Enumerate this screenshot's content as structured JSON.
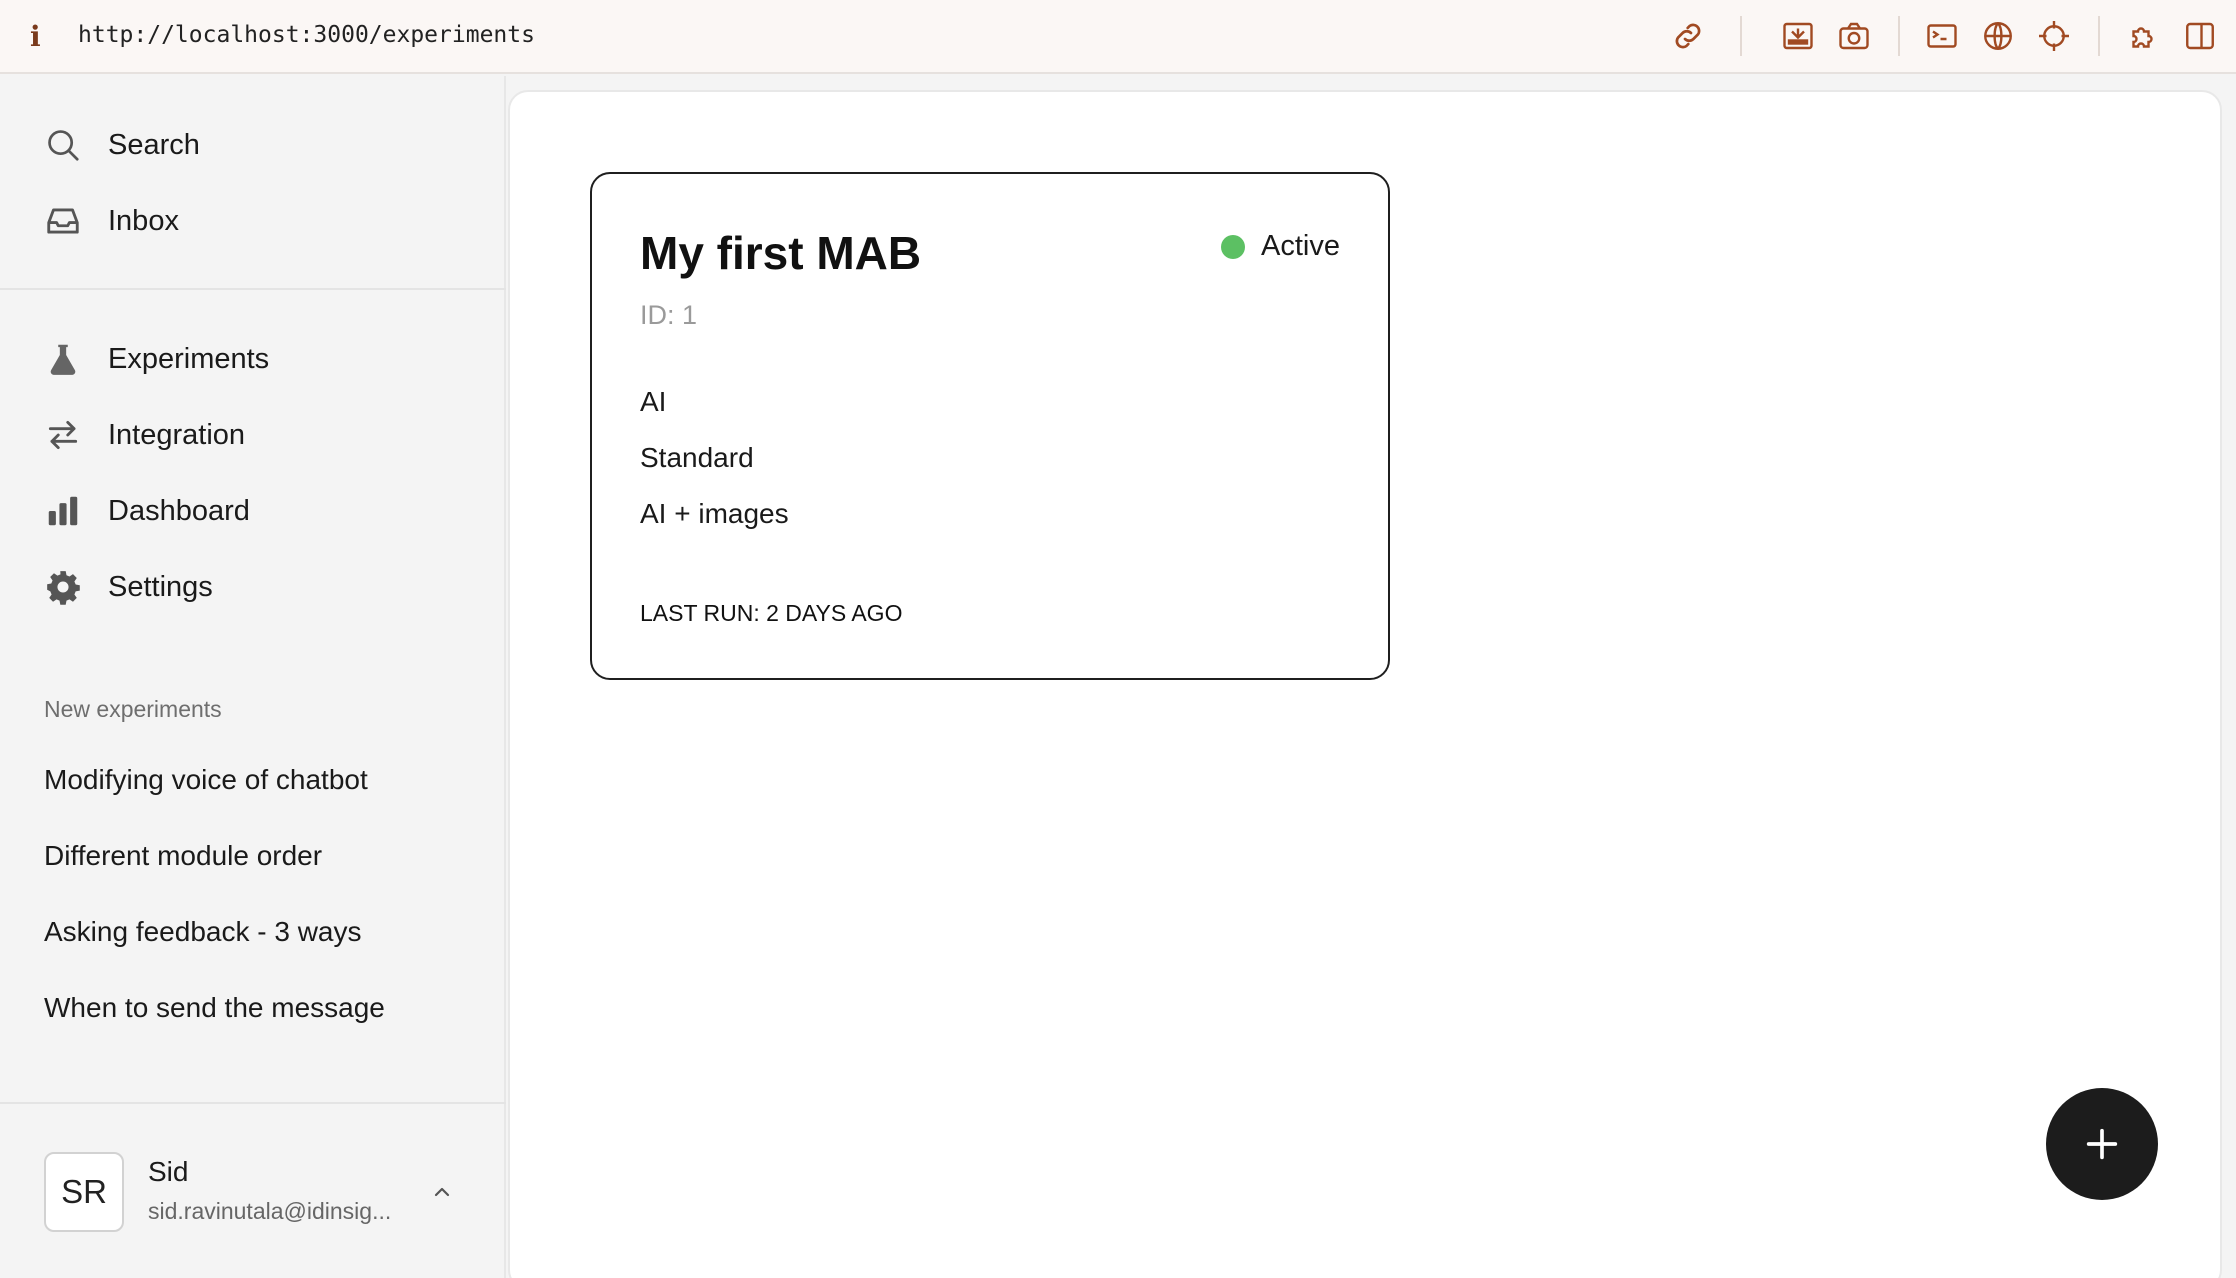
{
  "browser": {
    "info_glyph": "i",
    "url": "http://localhost:3000/experiments",
    "toolbar_icons": [
      "link-icon",
      "screenshot-area-icon",
      "camera-icon",
      "terminal-icon",
      "globe-icon",
      "crosshair-icon",
      "extensions-icon",
      "split-view-icon"
    ]
  },
  "sidebar": {
    "top_items": [
      {
        "label": "Search",
        "icon": "search-icon"
      },
      {
        "label": "Inbox",
        "icon": "inbox-icon"
      }
    ],
    "nav_items": [
      {
        "label": "Experiments",
        "icon": "flask-icon"
      },
      {
        "label": "Integration",
        "icon": "arrows-exchange-icon"
      },
      {
        "label": "Dashboard",
        "icon": "bar-chart-icon"
      },
      {
        "label": "Settings",
        "icon": "gear-icon"
      }
    ],
    "new_experiments_title": "New experiments",
    "new_experiments": [
      "Modifying voice of chatbot",
      "Different module order",
      "Asking feedback - 3 ways",
      "When to send the message"
    ],
    "user": {
      "initials": "SR",
      "name": "Sid",
      "email": "sid.ravinutala@idinsig..."
    }
  },
  "main": {
    "experiment_card": {
      "title": "My first MAB",
      "id_text": "ID: 1",
      "status": "Active",
      "status_color": "#5cc063",
      "arms": [
        "AI",
        "Standard",
        "AI + images"
      ],
      "last_run": "LAST RUN: 2 DAYS AGO"
    },
    "fab_icon": "plus-icon"
  }
}
